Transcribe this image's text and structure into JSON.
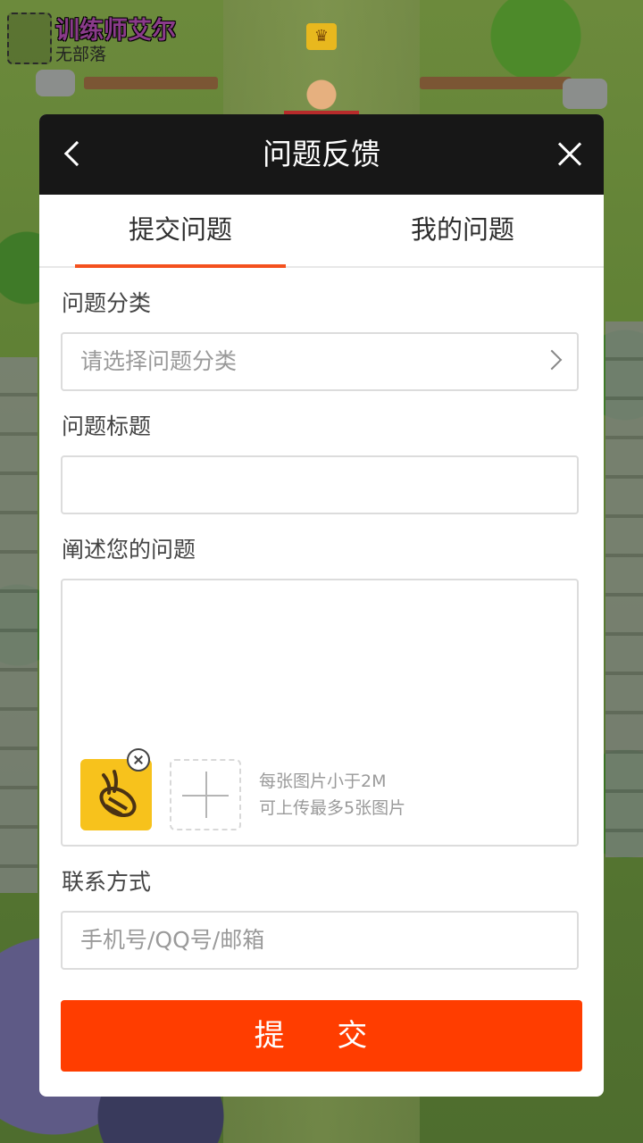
{
  "game_overlay": {
    "player_name": "训练师艾尔",
    "clan": "无部落"
  },
  "dialog": {
    "title": "问题反馈",
    "tabs": [
      {
        "label": "提交问题",
        "active": true
      },
      {
        "label": "我的问题",
        "active": false
      }
    ],
    "category": {
      "label": "问题分类",
      "placeholder": "请选择问题分类"
    },
    "title_field": {
      "label": "问题标题",
      "value": ""
    },
    "description": {
      "label": "阐述您的问题",
      "value": "",
      "upload_hint_line1": "每张图片小于2M",
      "upload_hint_line2": "可上传最多5张图片"
    },
    "contact": {
      "label": "联系方式",
      "placeholder": "手机号/QQ号/邮箱"
    },
    "submit_label": "提 交"
  },
  "colors": {
    "accent": "#ff3d00",
    "header_bg": "#171717",
    "tab_indicator": "#f4511e",
    "thumbnail_bg": "#f7c21c"
  },
  "icons": {
    "back": "chevron-left-icon",
    "close": "close-icon",
    "select": "chevron-right-icon",
    "thumbnail": "bee-app-icon",
    "remove": "remove-badge-icon",
    "add": "plus-icon"
  }
}
